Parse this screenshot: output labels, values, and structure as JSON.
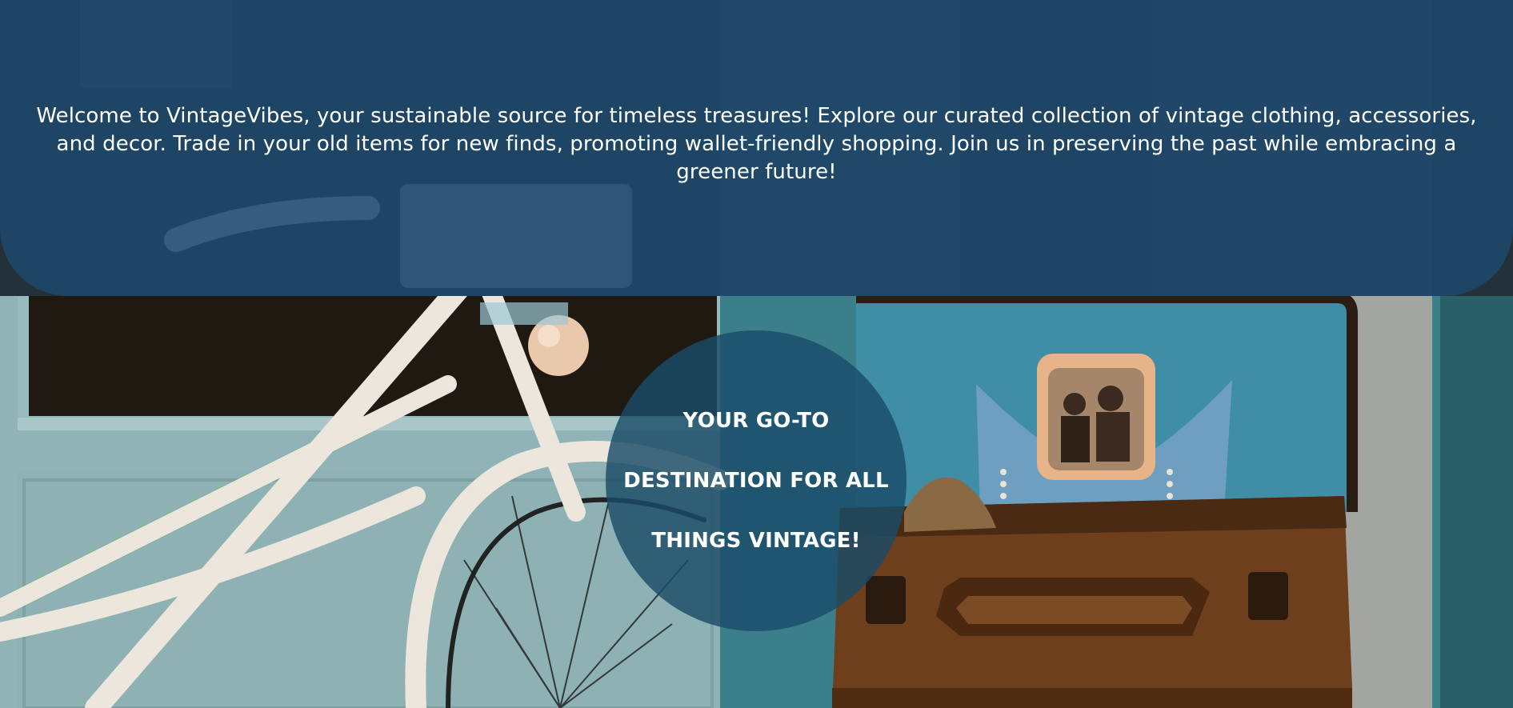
{
  "hero": {
    "background_image": "vintage-bicycle-and-suitcase-photo",
    "welcome_text": "Welcome to VintageVibes, your sustainable source for timeless treasures! Explore our curated collection of vintage clothing, accessories, and decor. Trade in your old items for new finds, promoting wallet-friendly shopping. Join us in preserving the past while embracing a greener future!",
    "tagline": "YOUR GO-TO DESTINATION FOR ALL THINGS VINTAGE!",
    "panel_color": "#1e486c",
    "circle_color": "#1a4c68"
  }
}
